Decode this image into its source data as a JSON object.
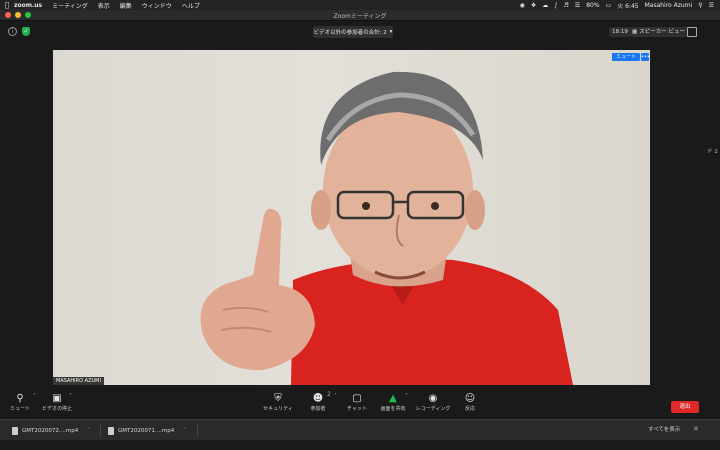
{
  "menubar": {
    "app": "zoom.us",
    "items": [
      "ミーティング",
      "表示",
      "編集",
      "ウィンドウ",
      "ヘルプ"
    ],
    "battery": "80%",
    "datetime": "火 6:45",
    "user": "Masahiro Azumi"
  },
  "window": {
    "title": "Zoomミーティング"
  },
  "top": {
    "participants_dropdown": "ビデオ以外の参加者の合計: 2",
    "timer": "18:19",
    "speaker_view": "スピーカー ビュー"
  },
  "video": {
    "name": "MASAHIRO AZUMI",
    "mute_label": "ミュート",
    "more_label": "•••",
    "side_tag": "ド 2"
  },
  "toolbar": {
    "mute": "ミュート",
    "stop_video": "ビデオの停止",
    "security": "セキュリティ",
    "participants": "参加者",
    "participants_count": "2",
    "chat": "チャット",
    "share_screen": "画面を共有",
    "record": "レコーディング",
    "reactions": "反応",
    "leave": "退出"
  },
  "downloads": {
    "files": [
      "GMT2020072....mp4",
      "GMT2020071....mp4"
    ],
    "show_all": "すべてを表示"
  }
}
